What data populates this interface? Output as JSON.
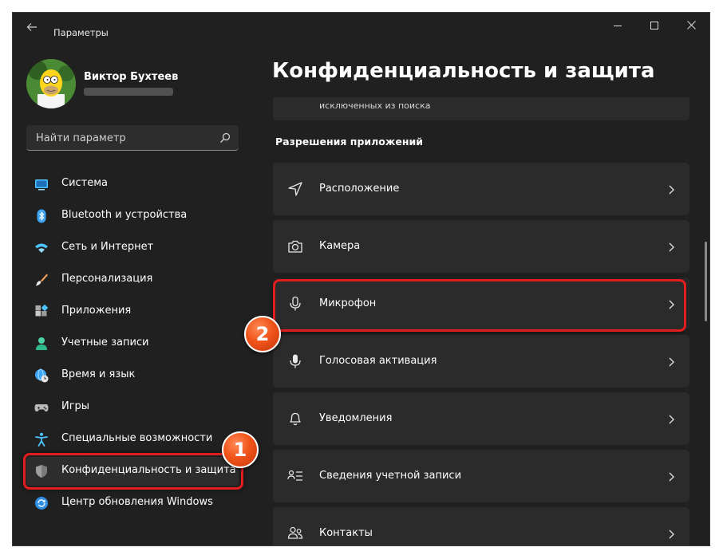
{
  "window": {
    "title": "Параметры",
    "back_icon": "back-arrow-icon",
    "controls": [
      "minimize-icon",
      "maximize-icon",
      "close-icon"
    ]
  },
  "user": {
    "name": "Виктор Бухтеев"
  },
  "search": {
    "placeholder": "Найти параметр",
    "value": ""
  },
  "sidebar": {
    "items": [
      {
        "label": "Система",
        "icon": "monitor-icon"
      },
      {
        "label": "Bluetooth и устройства",
        "icon": "bluetooth-icon"
      },
      {
        "label": "Сеть и Интернет",
        "icon": "wifi-icon"
      },
      {
        "label": "Персонализация",
        "icon": "brush-icon"
      },
      {
        "label": "Приложения",
        "icon": "apps-icon"
      },
      {
        "label": "Учетные записи",
        "icon": "person-icon"
      },
      {
        "label": "Время и язык",
        "icon": "globe-clock-icon"
      },
      {
        "label": "Игры",
        "icon": "gamepad-icon"
      },
      {
        "label": "Специальные возможности",
        "icon": "accessibility-icon"
      },
      {
        "label": "Конфиденциальность и защита",
        "icon": "shield-icon",
        "selected": true
      },
      {
        "label": "Центр обновления Windows",
        "icon": "update-icon"
      }
    ]
  },
  "main": {
    "title": "Конфиденциальность и защита",
    "partial_item": "исключенных из поиска",
    "section_header": "Разрешения приложений",
    "items": [
      {
        "label": "Расположение",
        "icon": "location-icon"
      },
      {
        "label": "Камера",
        "icon": "camera-icon"
      },
      {
        "label": "Микрофон",
        "icon": "microphone-icon"
      },
      {
        "label": "Голосовая активация",
        "icon": "voice-activation-icon"
      },
      {
        "label": "Уведомления",
        "icon": "bell-icon"
      },
      {
        "label": "Сведения учетной записи",
        "icon": "account-info-icon"
      },
      {
        "label": "Контакты",
        "icon": "contacts-icon"
      }
    ]
  },
  "annotations": {
    "badge_1": "1",
    "badge_2": "2",
    "highlight_color": "#e31d1d"
  },
  "colors": {
    "background": "#202020",
    "card": "#2b2b2b",
    "selected": "#2d2d2d",
    "accent": "#4cc2ff"
  }
}
